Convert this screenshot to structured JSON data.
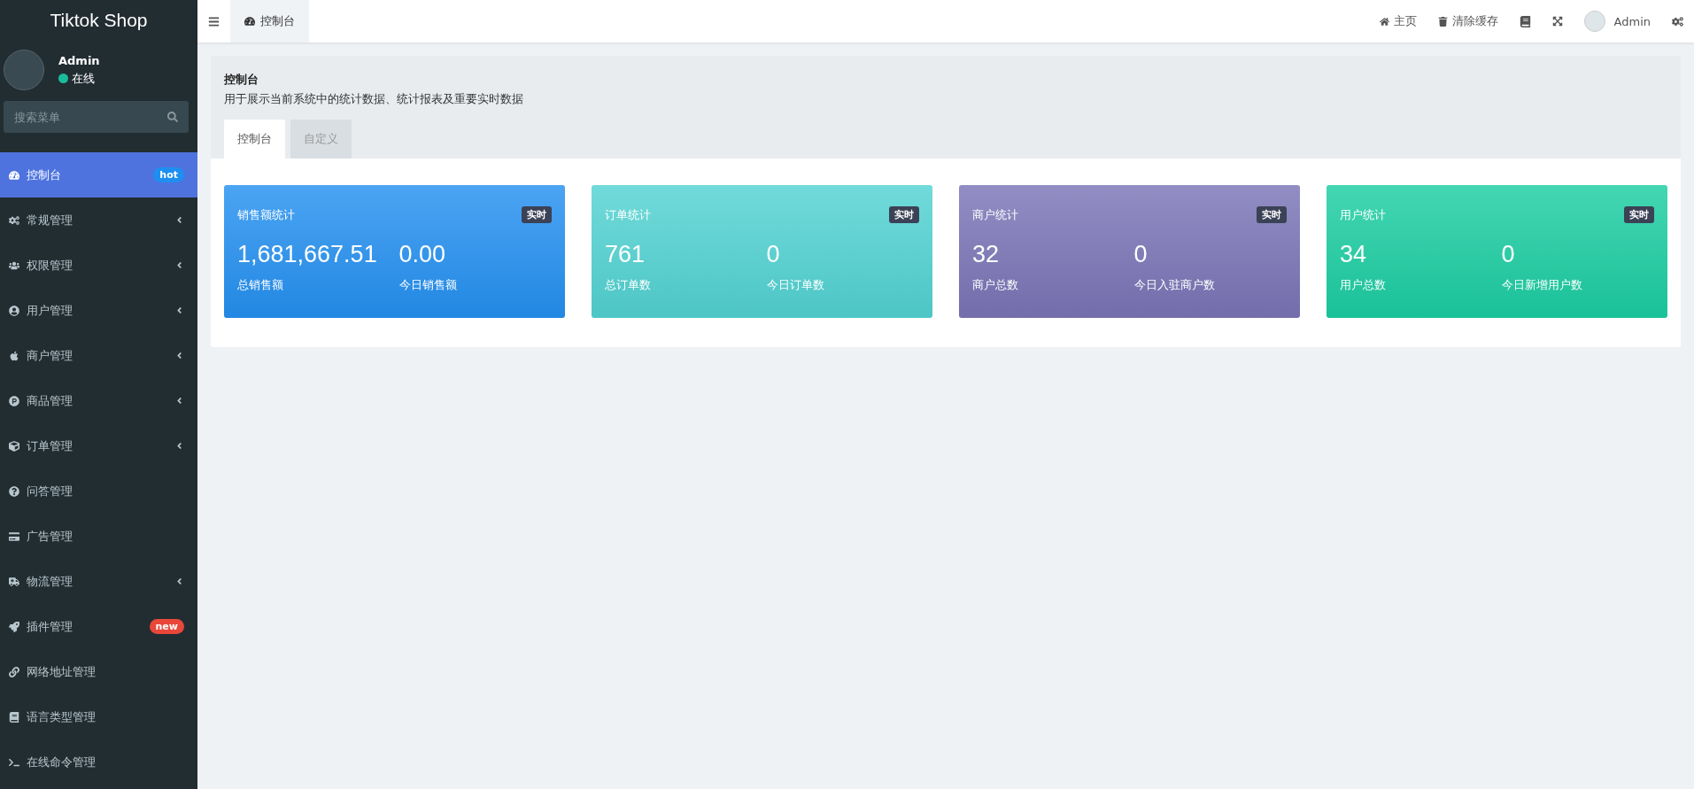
{
  "sidebar": {
    "logo": "Tiktok Shop",
    "user": {
      "name": "Admin",
      "status": "在线",
      "online": true
    },
    "search": {
      "placeholder": "搜索菜单"
    },
    "items": [
      {
        "label": "控制台",
        "selected": true,
        "expandable": false,
        "badge": {
          "text": "hot",
          "color": "#1e8ff0"
        }
      },
      {
        "label": "常规管理",
        "selected": false,
        "expandable": true
      },
      {
        "label": "权限管理",
        "selected": false,
        "expandable": true
      },
      {
        "label": "用户管理",
        "selected": false,
        "expandable": true
      },
      {
        "label": "商户管理",
        "selected": false,
        "expandable": true
      },
      {
        "label": "商品管理",
        "selected": false,
        "expandable": true
      },
      {
        "label": "订单管理",
        "selected": false,
        "expandable": true
      },
      {
        "label": "问答管理",
        "selected": false,
        "expandable": false
      },
      {
        "label": "广告管理",
        "selected": false,
        "expandable": false
      },
      {
        "label": "物流管理",
        "selected": false,
        "expandable": true
      },
      {
        "label": "插件管理",
        "selected": false,
        "expandable": false,
        "badge": {
          "text": "new",
          "color": "#e8473a"
        }
      },
      {
        "label": "网络地址管理",
        "selected": false,
        "expandable": false
      },
      {
        "label": "语言类型管理",
        "selected": false,
        "expandable": false
      },
      {
        "label": "在线命令管理",
        "selected": false,
        "expandable": false
      }
    ]
  },
  "header": {
    "tabs": [
      {
        "label": "控制台",
        "selected": true
      }
    ],
    "links": [
      "主页",
      "清除缓存"
    ],
    "user": "Admin"
  },
  "panel": {
    "title": "控制台",
    "description": "用于展示当前系统中的统计数据、统计报表及重要实时数据",
    "tabs": [
      {
        "label": "控制台",
        "selected": true
      },
      {
        "label": "自定义",
        "selected": false
      }
    ]
  },
  "cards": [
    {
      "title": "销售额统计",
      "badge": "实时",
      "color": "#2490f0",
      "stats": [
        {
          "value": "1,681,667.51",
          "label": "总销售额"
        },
        {
          "value": "0.00",
          "label": "今日销售额"
        }
      ]
    },
    {
      "title": "订单统计",
      "badge": "实时",
      "color": "#52d2d2",
      "stats": [
        {
          "value": "761",
          "label": "总订单数"
        },
        {
          "value": "0",
          "label": "今日订单数"
        }
      ]
    },
    {
      "title": "商户统计",
      "badge": "实时",
      "color": "#7a74b6",
      "stats": [
        {
          "value": "32",
          "label": "商户总数"
        },
        {
          "value": "0",
          "label": "今日入驻商户数"
        }
      ]
    },
    {
      "title": "用户统计",
      "badge": "实时",
      "color": "#1bcda2",
      "stats": [
        {
          "value": "34",
          "label": "用户总数"
        },
        {
          "value": "0",
          "label": "今日新增用户数"
        }
      ]
    }
  ]
}
